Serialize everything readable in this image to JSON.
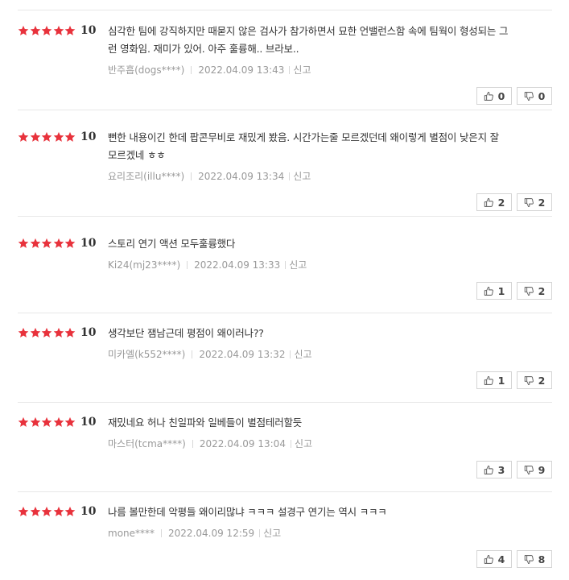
{
  "colors": {
    "star": "#e8323c",
    "text": "#333333",
    "meta": "#999999",
    "border": "#d4d4d4"
  },
  "icons": {
    "star": "star-icon",
    "like": "thumbs-up-icon",
    "dislike": "thumbs-down-icon"
  },
  "reviews": [
    {
      "stars": 5,
      "score": "10",
      "lines": [
        "심각한 팀에 강직하지만 때묻지 않은 검사가 참가하면서 묘한 언밸런스함 속에 팀웍이 형성되는 그",
        "런 영화임. 재미가 있어. 아주 훌륭해.. 브라보.."
      ],
      "author": "반주흡(dogs****)",
      "date": "2022.04.09 13:43",
      "report": "신고",
      "likes": "0",
      "dislikes": "0"
    },
    {
      "stars": 5,
      "score": "10",
      "lines": [
        "뻔한 내용이긴 한데 팝콘무비로 재밌게 봤음. 시간가는줄 모르겠던데 왜이렇게 별점이 낮은지 잘",
        "모르겠네 ㅎㅎ"
      ],
      "author": "요리조리(illu****)",
      "date": "2022.04.09 13:34",
      "report": "신고",
      "likes": "2",
      "dislikes": "2"
    },
    {
      "stars": 5,
      "score": "10",
      "lines": [
        "스토리 연기 액션 모두훌륭했다"
      ],
      "author": "Ki24(mj23****)",
      "date": "2022.04.09 13:33",
      "report": "신고",
      "likes": "1",
      "dislikes": "2"
    },
    {
      "stars": 5,
      "score": "10",
      "lines": [
        "생각보단 잼남근데 평점이 왜이러나??"
      ],
      "author": "미카엘(k552****)",
      "date": "2022.04.09 13:32",
      "report": "신고",
      "likes": "1",
      "dislikes": "2"
    },
    {
      "stars": 5,
      "score": "10",
      "lines": [
        "재밌네요 허나 친일파와 일베들이 별점테러할듯"
      ],
      "author": "마스터(tcma****)",
      "date": "2022.04.09 13:04",
      "report": "신고",
      "likes": "3",
      "dislikes": "9"
    },
    {
      "stars": 5,
      "score": "10",
      "lines": [
        "나름 볼만한데 악평들 왜이리많냐 ㅋㅋㅋ 설경구 연기는 역시 ㅋㅋㅋ"
      ],
      "author": "mone****",
      "date": "2022.04.09 12:59",
      "report": "신고",
      "likes": "4",
      "dislikes": "8"
    }
  ]
}
